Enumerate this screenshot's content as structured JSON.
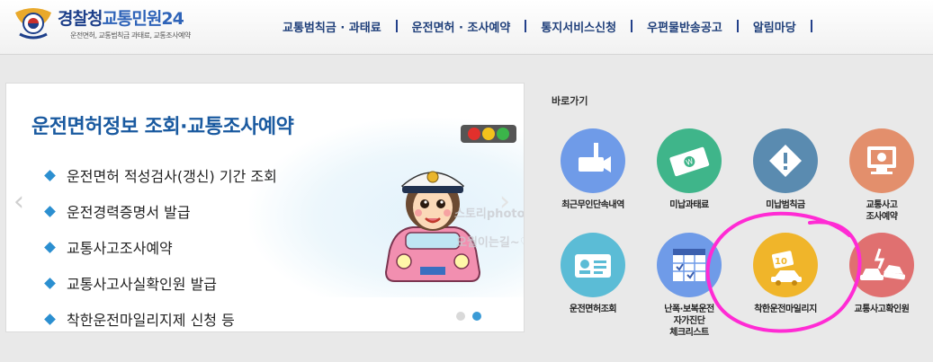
{
  "header": {
    "brand_main": "경찰청",
    "brand_sub": "교통민원24",
    "tagline": "운전면허, 교통범칙금 과태료, 교통조사예약",
    "nav": [
      "교통범칙금 · 과태료",
      "운전면허 · 조사예약",
      "통지서비스신청",
      "우편물반송공고",
      "알림마당"
    ]
  },
  "banner": {
    "title": "운전면허정보 조회·교통조사예약",
    "items": [
      "운전면허 적성검사(갱신) 기간 조회",
      "운전경력증명서 발급",
      "교통사고조사예약",
      "교통사고사실확인원 발급",
      "착한운전마일리지제 신청 등"
    ],
    "watermark_1": "스토리photo",
    "watermark_2": "오월이는길~♡"
  },
  "quick": {
    "title": "바로가기",
    "items": [
      {
        "label": "최근무인단속내역",
        "color": "#6f9be8",
        "icon": "camera-icon"
      },
      {
        "label": "미납과태료",
        "color": "#3fb58a",
        "icon": "banknote-icon"
      },
      {
        "label": "미납범칙금",
        "color": "#5a8bb0",
        "icon": "warning-icon"
      },
      {
        "label": "교통사고\n조사예약",
        "color": "#e38f6c",
        "icon": "monitor-icon"
      },
      {
        "label": "운전면허조회",
        "color": "#5bbcd6",
        "icon": "license-card-icon"
      },
      {
        "label": "난폭·보복운전\n자가진단\n체크리스트",
        "color": "#6f9be8",
        "icon": "checklist-icon"
      },
      {
        "label": "착한운전마일리지",
        "color": "#f0b52a",
        "icon": "mileage-car-icon"
      },
      {
        "label": "교통사고확인원",
        "color": "#e07070",
        "icon": "car-crash-icon"
      }
    ]
  },
  "colors": {
    "nav_text": "#1f3f7a",
    "banner_title": "#1a5aa0",
    "bullet": "#2b8fd0",
    "highlight_circle": "#ff2bd4"
  }
}
